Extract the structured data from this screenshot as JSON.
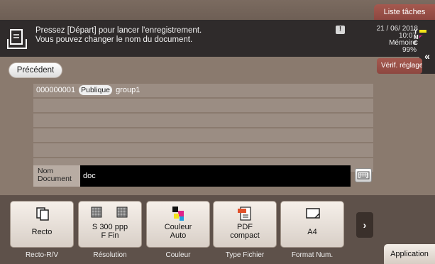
{
  "header": {
    "tab_liste": "Liste tâches"
  },
  "message": {
    "line1": "Pressez [Départ] pour lancer l'enregistrement.",
    "line2": "Vous pouvez changer le nom du document.",
    "warning_icon": "exclamation-icon"
  },
  "status": {
    "date": "21 / 06/ 2018",
    "time": "10:07",
    "memory_label": "Mémoire",
    "memory_value": "99%",
    "toner": [
      {
        "letter": "Y",
        "color": "#f2e21a"
      },
      {
        "letter": "M",
        "color": "#e0238a"
      },
      {
        "letter": "C",
        "color": "#1f9de0"
      }
    ],
    "collapse_icon": "double-chevron-left-icon",
    "verif_label": "Vérif. réglage"
  },
  "nav": {
    "back_label": "Précédent"
  },
  "document": {
    "id": "000000001",
    "badge": "Publique",
    "group": "group1",
    "empty_rows": 5
  },
  "name_field": {
    "label_line1": "Nom",
    "label_line2": "Document",
    "value": "doc"
  },
  "functions": [
    {
      "key": "recto",
      "value": "Recto",
      "caption": "Recto-R/V"
    },
    {
      "key": "resolution",
      "value_line1": "S 300 ppp",
      "value_line2": "F Fin",
      "caption": "Résolution"
    },
    {
      "key": "couleur",
      "value_line1": "Couleur",
      "value_line2": "Auto",
      "caption": "Couleur"
    },
    {
      "key": "type",
      "value_line1": "PDF",
      "value_line2": "compact",
      "caption": "Type Fichier"
    },
    {
      "key": "format",
      "value": "A4",
      "caption": "Format Num."
    }
  ],
  "footer": {
    "application_label": "Application"
  },
  "colors": {
    "tab_accent": "#a5594f",
    "panel_dark": "#2f2b2b",
    "background": "#8a7a6e"
  }
}
